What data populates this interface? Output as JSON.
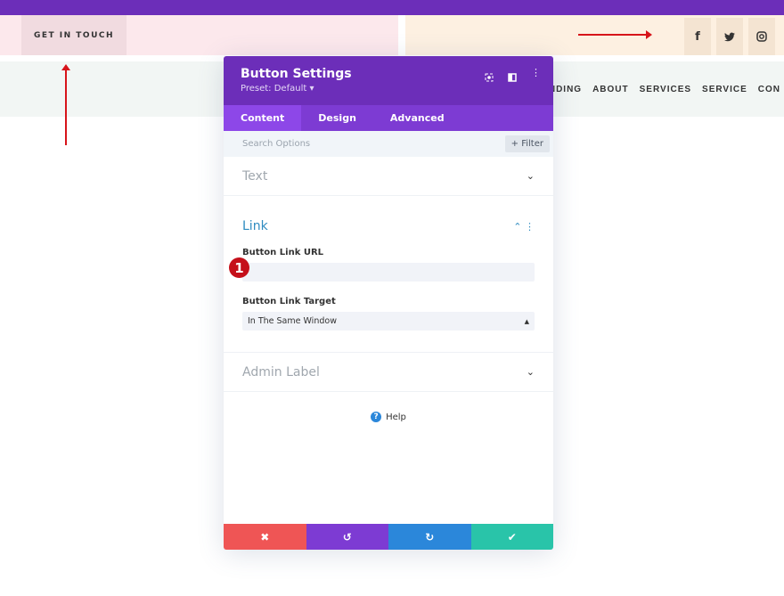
{
  "header": {
    "cta": "GET IN TOUCH",
    "social": [
      {
        "icon": "facebook-icon",
        "glyph": "f"
      },
      {
        "icon": "twitter-icon",
        "glyph": "t"
      },
      {
        "icon": "instagram-icon",
        "glyph": "i"
      }
    ],
    "nav": [
      "ANDING",
      "ABOUT",
      "SERVICES",
      "SERVICE",
      "CON"
    ]
  },
  "modal": {
    "title": "Button Settings",
    "preset": "Preset: Default ▾",
    "tabs": [
      "Content",
      "Design",
      "Advanced"
    ],
    "search_placeholder": "Search Options",
    "filter": "+ Filter",
    "sections": {
      "text": "Text",
      "link": "Link",
      "admin": "Admin Label"
    },
    "link_url_label": "Button Link URL",
    "link_url_value": "",
    "link_target_label": "Button Link Target",
    "link_target_value": "In The Same Window",
    "help": "Help",
    "badge": "1"
  },
  "colors": {
    "purple": "#6c2eb9",
    "cancel": "#ef5555",
    "undo": "#7d3bd3",
    "redo": "#2b87da",
    "save": "#29c4a9",
    "annotation": "#d7141a"
  }
}
